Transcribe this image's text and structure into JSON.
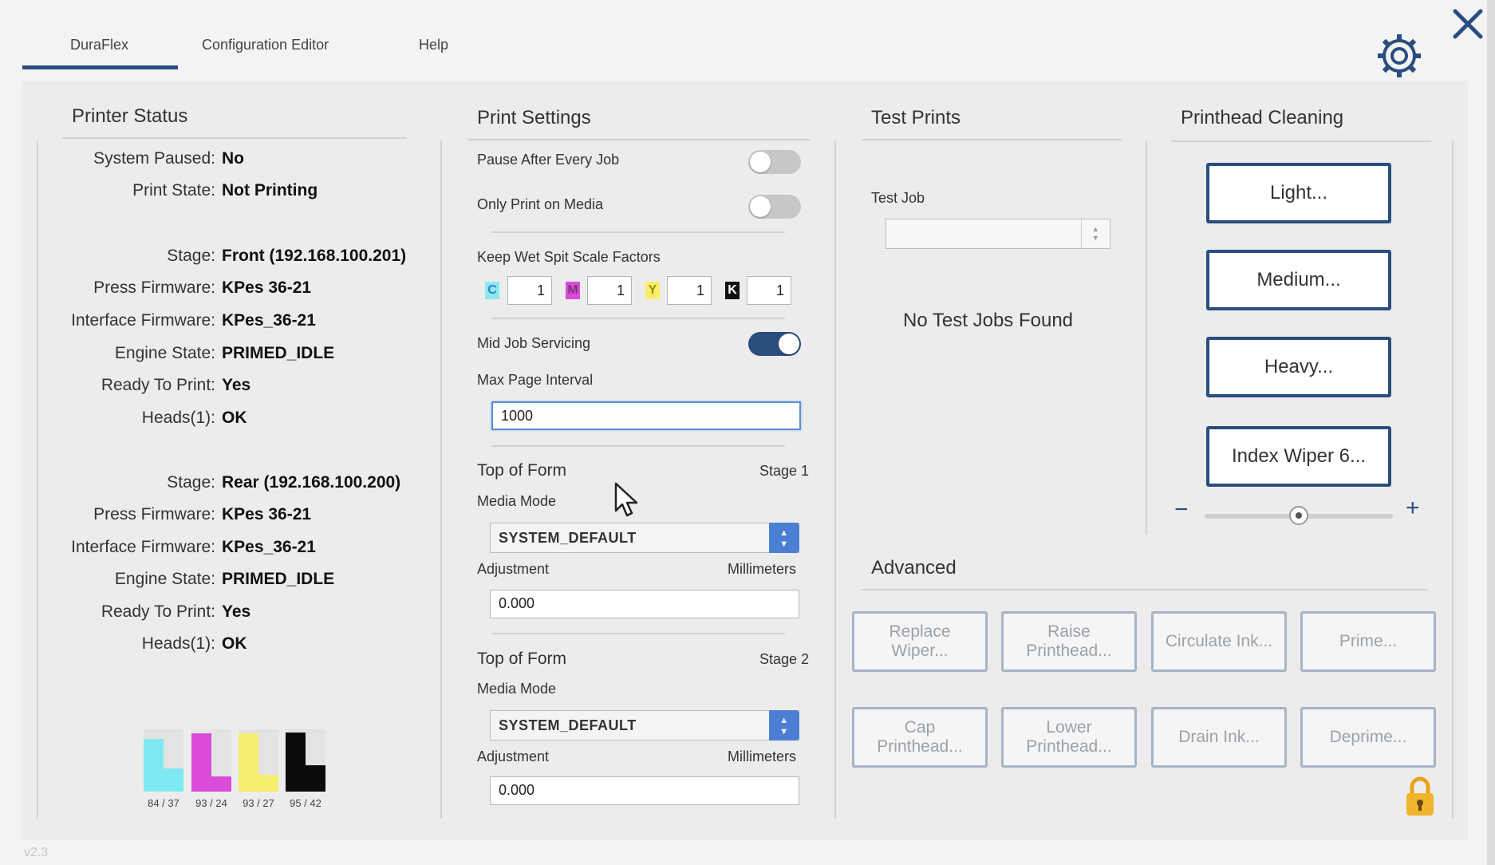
{
  "tabs": [
    {
      "label": "DuraFlex",
      "active": true
    },
    {
      "label": "Configuration Editor",
      "active": false
    },
    {
      "label": "Help",
      "active": false
    }
  ],
  "printer_status": {
    "title": "Printer Status",
    "rows": [
      {
        "label": "System Paused:",
        "value": "No"
      },
      {
        "label": "Print State:",
        "value": "Not Printing"
      },
      {
        "label": "Stage:",
        "value": "Front (192.168.100.201)"
      },
      {
        "label": "Press Firmware:",
        "value": "KPes 36-21"
      },
      {
        "label": "Interface Firmware:",
        "value": "KPes_36-21"
      },
      {
        "label": "Engine State:",
        "value": "PRIMED_IDLE"
      },
      {
        "label": "Ready To Print:",
        "value": "Yes"
      },
      {
        "label": "Heads(1):",
        "value": "OK"
      },
      {
        "label": "Stage:",
        "value": "Rear (192.168.100.200)"
      },
      {
        "label": "Press Firmware:",
        "value": "KPes 36-21"
      },
      {
        "label": "Interface Firmware:",
        "value": "KPes_36-21"
      },
      {
        "label": "Engine State:",
        "value": "PRIMED_IDLE"
      },
      {
        "label": "Ready To Print:",
        "value": "Yes"
      },
      {
        "label": "Heads(1):",
        "value": "OK"
      }
    ],
    "ink_levels": [
      {
        "caption": "84 / 37",
        "color": "#7fe9f2",
        "front": 84,
        "rear": 37
      },
      {
        "caption": "93 / 24",
        "color": "#d94bd8",
        "front": 93,
        "rear": 24
      },
      {
        "caption": "93 / 27",
        "color": "#f6ef6e",
        "front": 93,
        "rear": 27
      },
      {
        "caption": "95 / 42",
        "color": "#0b0b0b",
        "front": 95,
        "rear": 42
      }
    ]
  },
  "print_settings": {
    "title": "Print Settings",
    "pause_after_every_job": {
      "label": "Pause After Every Job",
      "on": false
    },
    "only_print_on_media": {
      "label": "Only Print on Media",
      "on": false
    },
    "keep_wet_label": "Keep Wet Spit Scale Factors",
    "spit_factors": [
      {
        "chip": "C",
        "value": "1",
        "color": "#8ee8f0"
      },
      {
        "chip": "M",
        "value": "1",
        "color": "#d94bd8"
      },
      {
        "chip": "Y",
        "value": "1",
        "color": "#f6ef6e"
      },
      {
        "chip": "K",
        "value": "1",
        "color": "#111111"
      }
    ],
    "mid_job_servicing": {
      "label": "Mid Job Servicing",
      "on": true
    },
    "max_page_interval": {
      "label": "Max Page Interval",
      "value": "1000"
    },
    "stage1": {
      "top_of_form": "Top of Form",
      "stage_label": "Stage 1",
      "media_mode_label": "Media Mode",
      "media_mode_value": "SYSTEM_DEFAULT",
      "adjustment_label": "Adjustment",
      "units_label": "Millimeters",
      "adjustment_value": "0.000"
    },
    "stage2": {
      "top_of_form": "Top of Form",
      "stage_label": "Stage 2",
      "media_mode_label": "Media Mode",
      "media_mode_value": "SYSTEM_DEFAULT",
      "adjustment_label": "Adjustment",
      "units_label": "Millimeters",
      "adjustment_value": "0.000"
    }
  },
  "test_prints": {
    "title": "Test Prints",
    "test_job_label": "Test Job",
    "test_job_value": "",
    "empty_message": "No Test Jobs Found"
  },
  "printhead_cleaning": {
    "title": "Printhead Cleaning",
    "buttons": [
      "Light...",
      "Medium...",
      "Heavy...",
      "Index Wiper 6..."
    ],
    "minus": "−",
    "plus": "+",
    "slider_fraction": 0.5
  },
  "advanced": {
    "title": "Advanced",
    "buttons": [
      [
        "Replace",
        "Wiper..."
      ],
      [
        "Raise",
        "Printhead..."
      ],
      [
        "Circulate Ink..."
      ],
      [
        "Prime..."
      ],
      [
        "Cap",
        "Printhead..."
      ],
      [
        "Lower",
        "Printhead..."
      ],
      [
        "Drain Ink..."
      ],
      [
        "Deprime..."
      ]
    ]
  },
  "version": "v2.3",
  "colors": {
    "accent": "#2a4e7e",
    "select_arrow": "#4a7fd4",
    "lock": "#f0b52c"
  }
}
